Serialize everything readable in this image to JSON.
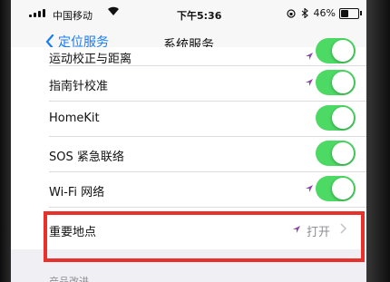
{
  "status_bar": {
    "carrier": "中国移动",
    "time": "下午5:36",
    "battery": "46%",
    "battery_level": 0.46
  },
  "nav": {
    "back_label": "定位服务",
    "title": "系统服务"
  },
  "rows": [
    {
      "label": "运动校正与距离",
      "location_icon": "location-arrow-icon",
      "toggle_on": true
    },
    {
      "label": "指南针校准",
      "location_icon": "location-arrow-icon",
      "toggle_on": true
    },
    {
      "label": "HomeKit",
      "toggle_on": true
    },
    {
      "label": "SOS 紧急联络",
      "toggle_on": true
    },
    {
      "label": "Wi-Fi 网络",
      "location_icon": "location-arrow-icon",
      "toggle_on": true
    }
  ],
  "significant_locations": {
    "label": "重要地点",
    "value": "打开"
  },
  "footer": {
    "label": "产品改进"
  },
  "colors": {
    "toggle_on": "#4cd964",
    "link": "#1a7cf5",
    "location_arrow": "#8e44ad",
    "highlight": "#e8312a"
  }
}
